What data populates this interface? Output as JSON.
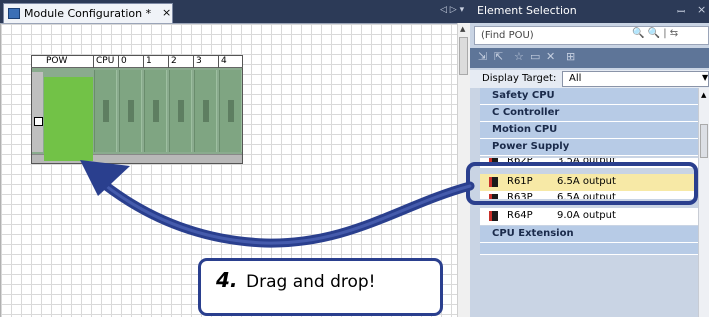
{
  "left_pane": {
    "tab_title": "Module Configuration *",
    "tab_close": "×",
    "tab_arrows": "◁ ▷ ▾",
    "base_unit": {
      "slots": [
        "POW",
        "CPU",
        "0",
        "1",
        "2",
        "3",
        "4"
      ]
    }
  },
  "right_pane": {
    "title": "Element Selection",
    "pin": "ꟷ",
    "close": "×",
    "find_placeholder": "(Find POU)",
    "find_buttons": "🔍 🔍 | ⇆",
    "toolbar_icons": [
      "⇲",
      "⇱",
      "☆",
      "▭",
      "✕",
      "⊞"
    ],
    "display_target_label": "Display Target:",
    "display_target_value": "All",
    "categories": {
      "safety_cpu": "Safety CPU",
      "c_controller": "C Controller",
      "motion_cpu": "Motion CPU",
      "power_supply": "Power Supply",
      "cpu_extension": "CPU Extension"
    },
    "items": [
      {
        "name": "R62P",
        "desc": "3.5A output"
      },
      {
        "name": "R61P",
        "desc": "6.5A output"
      },
      {
        "name": "R63P",
        "desc": "6.5A output"
      },
      {
        "name": "R64P",
        "desc": "9.0A output"
      }
    ]
  },
  "callout": {
    "step_number": "4.",
    "text": "Drag and drop!"
  },
  "colors": {
    "highlight": "#2a3f8e",
    "power_module": "#72c247",
    "selected_row": "#f7e9a6"
  }
}
